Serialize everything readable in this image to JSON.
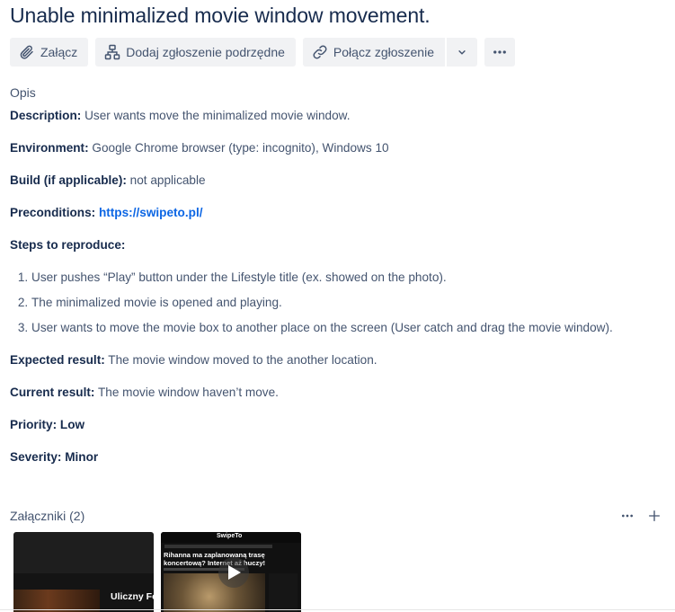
{
  "issue": {
    "title": "Unable minimalized movie window movement."
  },
  "toolbar": {
    "attach_label": "Załącz",
    "child_issue_label": "Dodaj zgłoszenie podrzędne",
    "link_issue_label": "Połącz zgłoszenie",
    "icons": {
      "attach": "paperclip-icon",
      "child": "child-issue-icon",
      "link": "link-icon",
      "caret": "chevron-down-icon",
      "more": "more-icon"
    }
  },
  "description": {
    "heading": "Opis",
    "description_label": "Description:",
    "description_value": " User wants move the minimalized movie window.",
    "environment_label": "Environment:",
    "environment_value": " Google Chrome browser (type: incognito), Windows 10",
    "build_label": "Build (if applicable):",
    "build_value": " not applicable",
    "preconditions_label": "Preconditions:",
    "preconditions_link": "https://swipeto.pl/",
    "steps_label": "Steps to reproduce:",
    "steps": [
      "User pushes “Play” button under the Lifestyle title (ex. showed on the photo).",
      "The minimalized movie is opened and playing.",
      "User wants to move the movie box to another place on the screen (User catch and drag the movie window)."
    ],
    "expected_label": "Expected result:",
    "expected_value": " The movie window moved to the another location.",
    "current_label": "Current result:",
    "current_value": " The movie window haven’t move.",
    "priority": "Priority: Low",
    "severity": "Severity: Minor"
  },
  "attachments": {
    "title": "Załączniki (2)",
    "items": [
      {
        "caption": "Uliczny Fo"
      },
      {
        "logo": "SwipeTo",
        "headline": "Rihanna ma zaplanowaną trasę koncertową? Internet aż huczy!"
      }
    ]
  },
  "colors": {
    "link": "#0c66e4",
    "button_bg": "#f1f2f4",
    "text": "#172b4d",
    "muted": "#44546f"
  }
}
